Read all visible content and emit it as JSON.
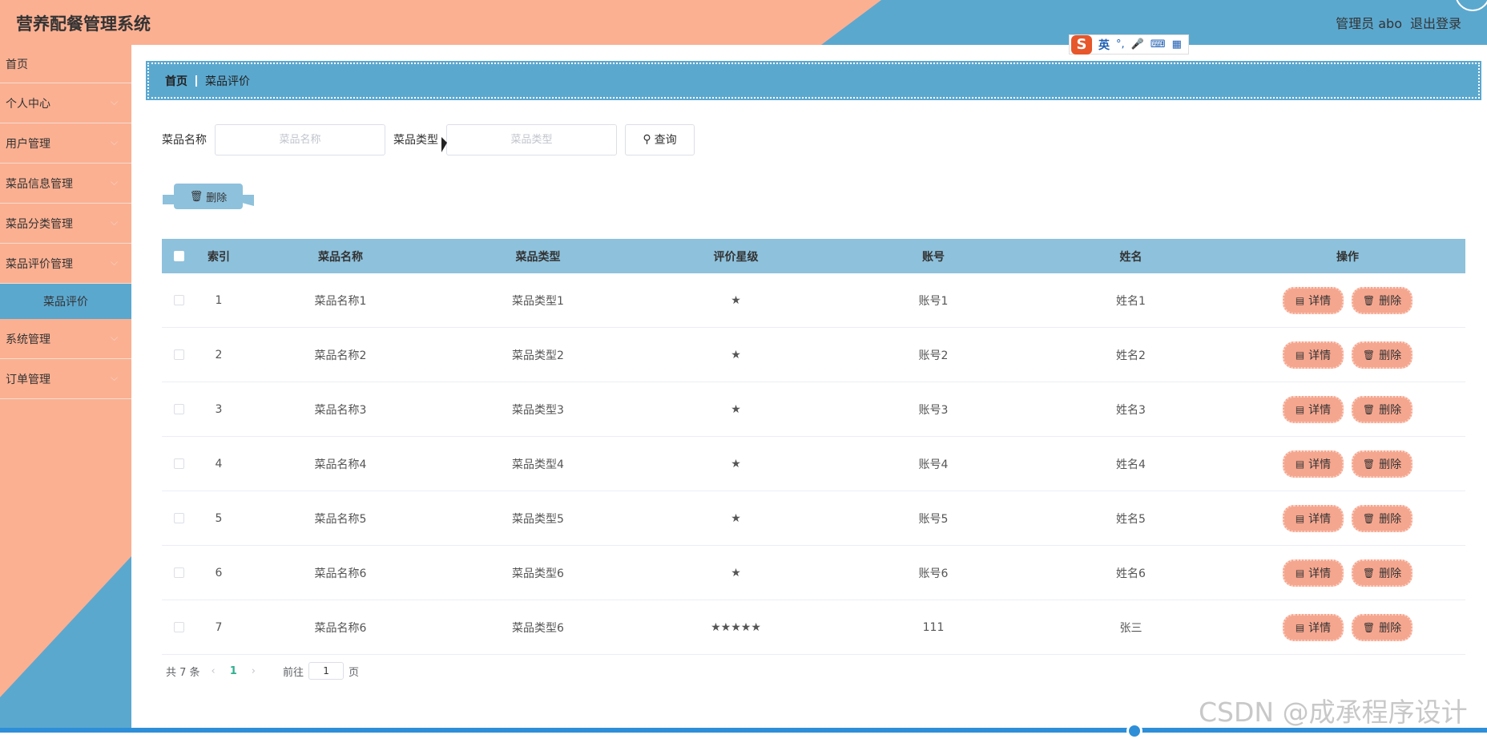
{
  "header": {
    "title": "营养配餐管理系统",
    "admin_text": "管理员 abo",
    "logout_label": "退出登录"
  },
  "ime": {
    "mode": "英",
    "symbol": "°,",
    "mic": "🎤",
    "keyboard": "⌨",
    "grid": "▦"
  },
  "sidebar": {
    "items": [
      {
        "label": "首页",
        "has_chevron": false
      },
      {
        "label": "个人中心",
        "has_chevron": true
      },
      {
        "label": "用户管理",
        "has_chevron": true
      },
      {
        "label": "菜品信息管理",
        "has_chevron": true
      },
      {
        "label": "菜品分类管理",
        "has_chevron": true
      },
      {
        "label": "菜品评价管理",
        "has_chevron": true
      },
      {
        "label": "系统管理",
        "has_chevron": true
      },
      {
        "label": "订单管理",
        "has_chevron": true
      }
    ],
    "active_sub": "菜品评价"
  },
  "breadcrumb": {
    "home": "首页",
    "current": "菜品评价"
  },
  "search": {
    "name_label": "菜品名称",
    "name_placeholder": "菜品名称",
    "type_label": "菜品类型",
    "type_placeholder": "菜品类型",
    "query_label": "查询"
  },
  "batch_delete_label": "删除",
  "table": {
    "headers": [
      "索引",
      "菜品名称",
      "菜品类型",
      "评价星级",
      "账号",
      "姓名",
      "操作"
    ],
    "rows": [
      {
        "index": "1",
        "name": "菜品名称1",
        "type": "菜品类型1",
        "stars": "★",
        "account": "账号1",
        "username": "姓名1"
      },
      {
        "index": "2",
        "name": "菜品名称2",
        "type": "菜品类型2",
        "stars": "★",
        "account": "账号2",
        "username": "姓名2"
      },
      {
        "index": "3",
        "name": "菜品名称3",
        "type": "菜品类型3",
        "stars": "★",
        "account": "账号3",
        "username": "姓名3"
      },
      {
        "index": "4",
        "name": "菜品名称4",
        "type": "菜品类型4",
        "stars": "★",
        "account": "账号4",
        "username": "姓名4"
      },
      {
        "index": "5",
        "name": "菜品名称5",
        "type": "菜品类型5",
        "stars": "★",
        "account": "账号5",
        "username": "姓名5"
      },
      {
        "index": "6",
        "name": "菜品名称6",
        "type": "菜品类型6",
        "stars": "★",
        "account": "账号6",
        "username": "姓名6"
      },
      {
        "index": "7",
        "name": "菜品名称6",
        "type": "菜品类型6",
        "stars": "★★★★★",
        "account": "111",
        "username": "张三"
      }
    ],
    "detail_label": "详情",
    "delete_label": "删除"
  },
  "pager": {
    "total": "共 7 条",
    "current_page": "1",
    "goto_label": "前往",
    "goto_value": "1",
    "page_suffix": "页"
  },
  "watermark": "CSDN @成承程序设计",
  "colors": {
    "peach": "#fbb092",
    "blue": "#5ba8cf",
    "light_blue": "#8ec1dc",
    "op_button": "#f5a68f"
  }
}
